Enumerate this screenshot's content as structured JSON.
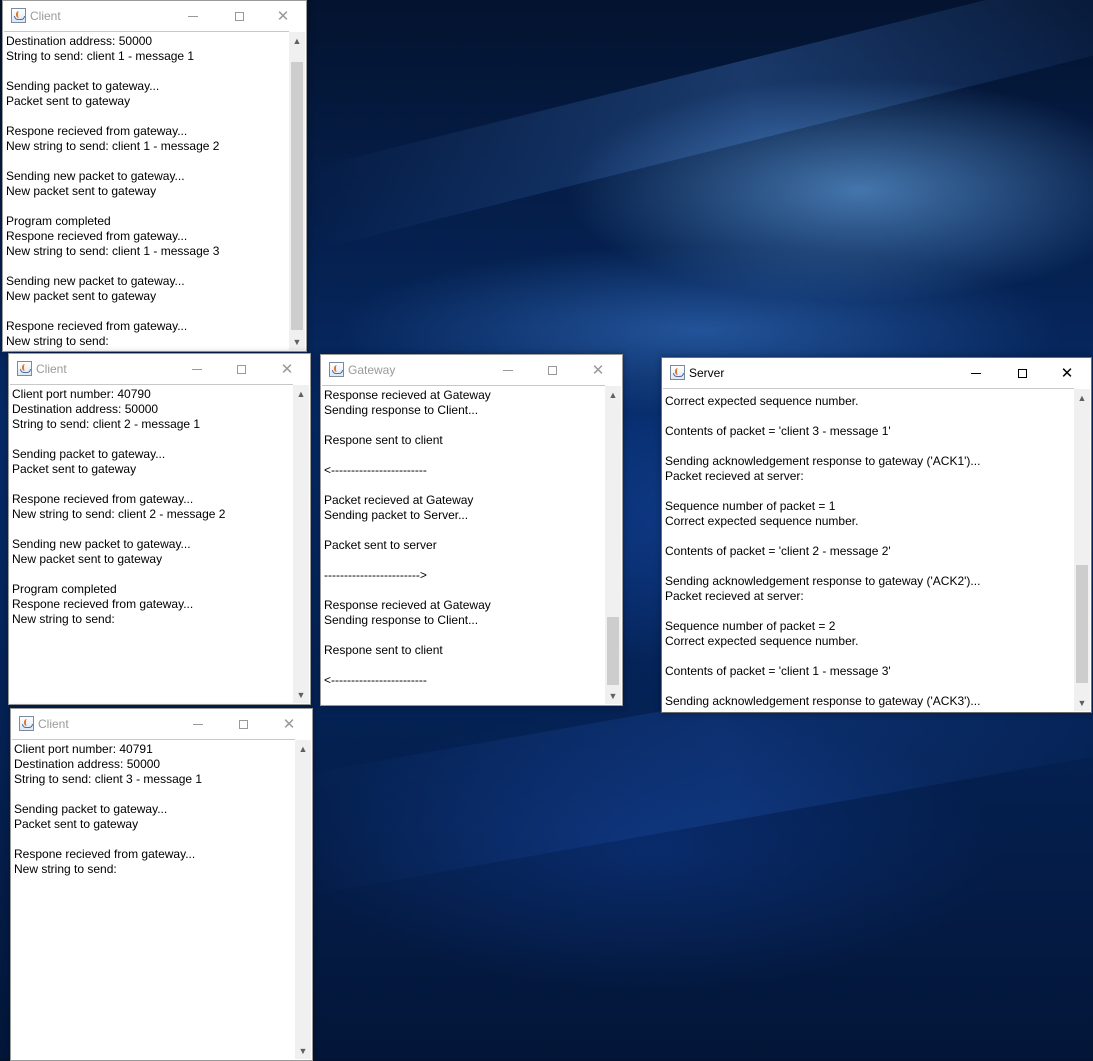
{
  "icons": {
    "app": "java-cup-icon",
    "minimize": "minimize-icon",
    "maximize": "maximize-icon",
    "close": "close-icon"
  },
  "glyphs": {
    "close": "✕",
    "up": "▲",
    "down": "▼"
  },
  "windows": {
    "client1": {
      "title": "Client",
      "lines": [
        "Destination address: 50000",
        "String to send: client 1 - message 1",
        "",
        "Sending packet to gateway...",
        "Packet sent to gateway",
        "",
        "Respone recieved from gateway...",
        "New string to send: client 1 - message 2",
        "",
        "Sending new packet to gateway...",
        "New packet sent to gateway",
        "",
        "Program completed",
        "Respone recieved from gateway...",
        "New string to send: client 1 - message 3",
        "",
        "Sending new packet to gateway...",
        "New packet sent to gateway",
        "",
        "Respone recieved from gateway...",
        "New string to send:"
      ]
    },
    "client2": {
      "title": "Client",
      "lines": [
        "Client port number: 40790",
        "Destination address: 50000",
        "String to send: client 2 - message 1",
        "",
        "Sending packet to gateway...",
        "Packet sent to gateway",
        "",
        "Respone recieved from gateway...",
        "New string to send: client 2 - message 2",
        "",
        "Sending new packet to gateway...",
        "New packet sent to gateway",
        "",
        "Program completed",
        "Respone recieved from gateway...",
        "New string to send:"
      ]
    },
    "client3": {
      "title": "Client",
      "lines": [
        "Client port number: 40791",
        "Destination address: 50000",
        "String to send: client 3 - message 1",
        "",
        "Sending packet to gateway...",
        "Packet sent to gateway",
        "",
        "Respone recieved from gateway...",
        "New string to send:"
      ]
    },
    "gateway": {
      "title": "Gateway",
      "lines": [
        "Response recieved at Gateway",
        "Sending response to Client...",
        "",
        "Respone sent to client",
        "",
        "<------------------------",
        "",
        "Packet recieved at Gateway",
        "Sending packet to Server...",
        "",
        "Packet sent to server",
        "",
        "------------------------>",
        "",
        "Response recieved at Gateway",
        "Sending response to Client...",
        "",
        "Respone sent to client",
        "",
        "<------------------------"
      ]
    },
    "server": {
      "title": "Server",
      "lines": [
        "Correct expected sequence number.",
        "",
        "Contents of packet = 'client 3 - message 1'",
        "",
        "Sending acknowledgement response to gateway ('ACK1')...",
        "Packet recieved at server:",
        "",
        "Sequence number of packet = 1",
        "Correct expected sequence number.",
        "",
        "Contents of packet = 'client 2 - message 2'",
        "",
        "Sending acknowledgement response to gateway ('ACK2')...",
        "Packet recieved at server:",
        "",
        "Sequence number of packet = 2",
        "Correct expected sequence number.",
        "",
        "Contents of packet = 'client 1 - message 3'",
        "",
        "Sending acknowledgement response to gateway ('ACK3')..."
      ]
    }
  }
}
